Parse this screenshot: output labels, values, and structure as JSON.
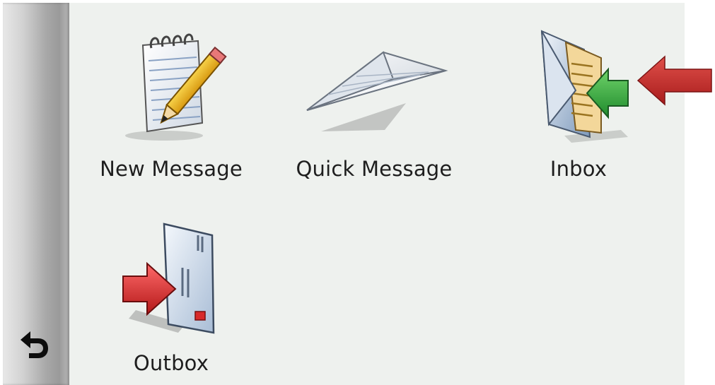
{
  "menu": {
    "items": [
      {
        "id": "new-message",
        "label": "New Message",
        "icon": "notepad-pencil-icon"
      },
      {
        "id": "quick-message",
        "label": "Quick Message",
        "icon": "paper-airplane-icon"
      },
      {
        "id": "inbox",
        "label": "Inbox",
        "icon": "inbox-envelope-icon"
      },
      {
        "id": "outbox",
        "label": "Outbox",
        "icon": "outbox-envelope-icon"
      }
    ]
  },
  "sidebar": {
    "back_icon": "back-arrow-icon"
  },
  "annotation": {
    "icon": "red-pointer-arrow-icon",
    "color": "#c0282a",
    "target": "inbox"
  },
  "colors": {
    "background": "#eef1ee",
    "text": "#1e1e1e",
    "inbox_arrow": "#2a9a3a",
    "outbox_arrow": "#d22a2a"
  }
}
